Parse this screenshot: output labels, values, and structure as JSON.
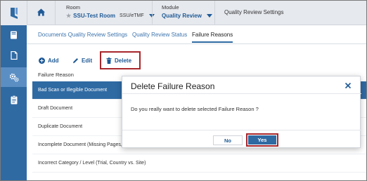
{
  "header": {
    "room_label": "Room",
    "room_value": "SSU-Test Room",
    "room_sub": "SSU/eTMF",
    "module_label": "Module",
    "module_value": "Quality Review",
    "page_title": "Quality Review Settings"
  },
  "sidebar": {
    "items": [
      {
        "icon": "book-icon"
      },
      {
        "icon": "document-icon"
      },
      {
        "icon": "gears-icon",
        "active": true
      },
      {
        "icon": "clipboard-icon"
      }
    ]
  },
  "tabs": [
    {
      "label": "Documents Quality Review Settings"
    },
    {
      "label": "Quality Review Status"
    },
    {
      "label": "Failure Reasons",
      "active": true
    }
  ],
  "toolbar": {
    "add_label": "Add",
    "edit_label": "Edit",
    "delete_label": "Delete"
  },
  "grid": {
    "header": "Failure Reason",
    "rows": [
      "Bad Scan or Illegible Document",
      "Draft Document",
      "Duplicate Document",
      "Incomplete Document (Missing Pages, e",
      "Incorrect Category / Level (Trial, Country vs. Site)"
    ],
    "selected_index": 0
  },
  "modal": {
    "title": "Delete Failure Reason",
    "message": "Do you really want to delete selected Failure Reason ?",
    "no_label": "No",
    "yes_label": "Yes"
  },
  "colors": {
    "brand_blue": "#2f6aa3",
    "highlight_red": "#a8262b"
  }
}
